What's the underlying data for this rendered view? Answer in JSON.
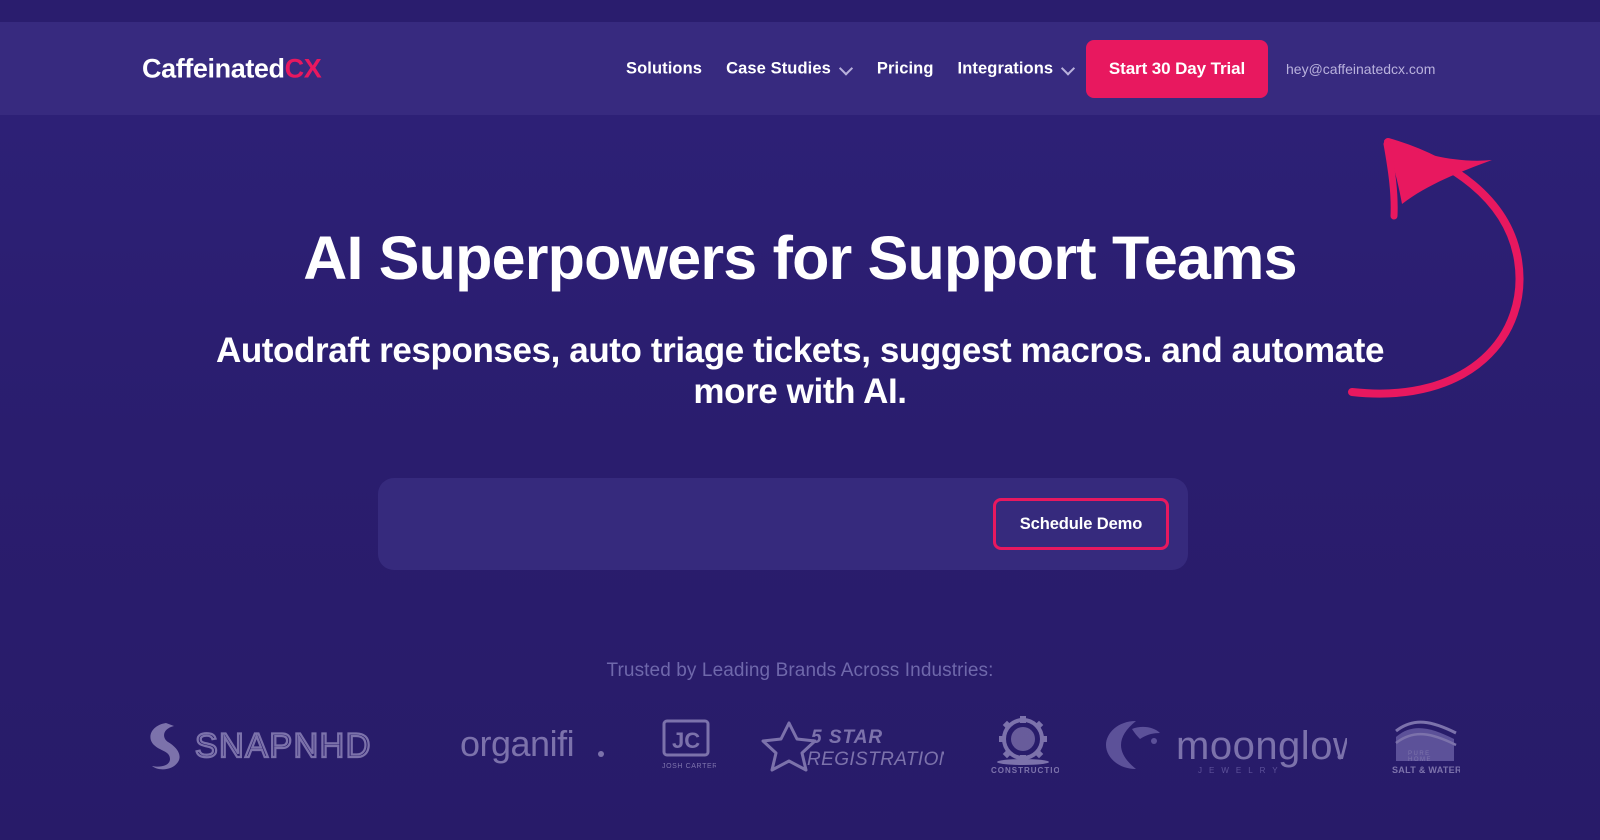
{
  "header": {
    "logo_main": "Caffeinated",
    "logo_accent": "CX",
    "nav": [
      {
        "label": "Solutions",
        "has_dropdown": false,
        "name": "solutions"
      },
      {
        "label": "Case Studies",
        "has_dropdown": true,
        "name": "case-studies"
      },
      {
        "label": "Pricing",
        "has_dropdown": false,
        "name": "pricing"
      },
      {
        "label": "Integrations",
        "has_dropdown": true,
        "name": "integrations"
      }
    ],
    "trial_button": "Start 30 Day Trial",
    "email": "hey@caffeinatedcx.com"
  },
  "hero": {
    "title": "AI Superpowers for Support Teams",
    "subtitle": "Autodraft responses, auto triage tickets, suggest macros. and automate more with AI.",
    "cta": {
      "input_value": "",
      "input_placeholder": "",
      "demo_button": "Schedule Demo"
    }
  },
  "trusted": {
    "label": "Trusted by Leading Brands Across Industries:",
    "brands": [
      {
        "name": "snapnhd",
        "label": "SNAPNHD",
        "sub": ""
      },
      {
        "name": "organifi",
        "label": "organifi",
        "sub": ""
      },
      {
        "name": "josh-carter",
        "label": "JC",
        "sub": "JOSH CARTER"
      },
      {
        "name": "5-star-registration",
        "label": "5 STAR",
        "sub": "REGISTRATION"
      },
      {
        "name": "construction",
        "label": "",
        "sub": "CONSTRUCTION"
      },
      {
        "name": "moonglow",
        "label": "moonglow",
        "sub": "J E W E L R Y"
      },
      {
        "name": "salt-and-water",
        "label": "",
        "sub": "SALT & WATER"
      }
    ]
  },
  "colors": {
    "top_strip": "#2a1d6e",
    "header_bg": "#372a7f",
    "hero_bg": "#2a1d6e",
    "accent_pink": "#e8185f",
    "panel_bg": "#362a7d",
    "muted_text": "#6f68ab"
  }
}
